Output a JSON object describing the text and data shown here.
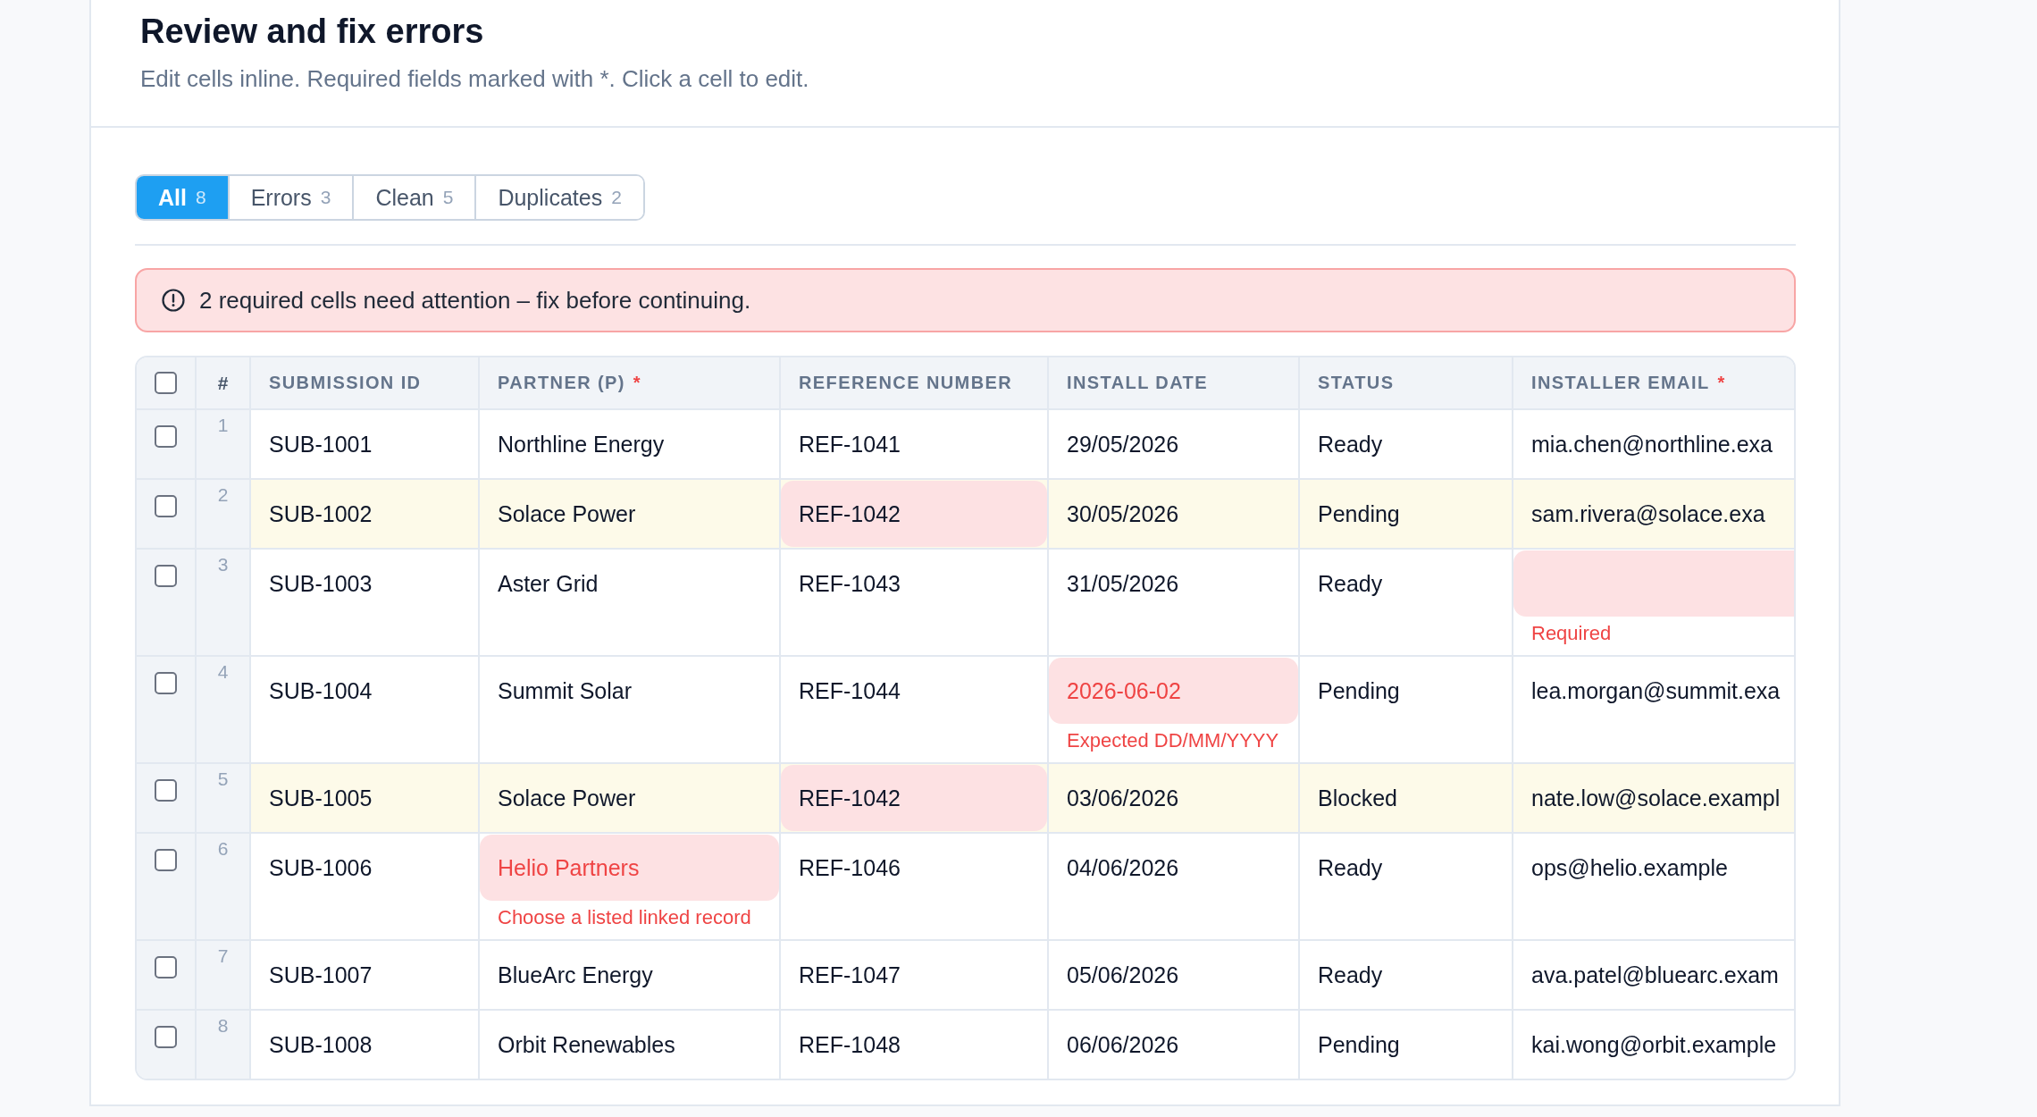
{
  "page": {
    "title": "Review and fix errors",
    "subtitle": "Edit cells inline. Required fields marked with *. Click a cell to edit."
  },
  "filter_tabs": [
    {
      "label": "All",
      "count": "8",
      "selected": true
    },
    {
      "label": "Errors",
      "count": "3",
      "selected": false
    },
    {
      "label": "Clean",
      "count": "5",
      "selected": false
    },
    {
      "label": "Duplicates",
      "count": "2",
      "selected": false
    }
  ],
  "alert": {
    "kind": "error",
    "message": "2 required cells need attention – fix before continuing."
  },
  "table": {
    "select_all_checked": false,
    "index_label": "#",
    "columns": [
      {
        "label": "SUBMISSION ID"
      },
      {
        "label": "PARTNER (P)",
        "marker": "*"
      },
      {
        "label": "REFERENCE NUMBER"
      },
      {
        "label": "INSTALL DATE"
      },
      {
        "label": "STATUS"
      },
      {
        "label": "INSTALLER EMAIL",
        "marker": "*"
      }
    ],
    "rows": [
      {
        "number": "1",
        "checked": false,
        "duplicate": false,
        "cells": [
          {
            "value": "SUB-1001",
            "kind": "plain"
          },
          {
            "value": "Northline Energy",
            "kind": "plain"
          },
          {
            "value": "REF-1041",
            "kind": "plain"
          },
          {
            "value": "29/05/2026",
            "kind": "plain"
          },
          {
            "value": "Ready",
            "kind": "plain"
          },
          {
            "value": "mia.chen@northline.exa",
            "kind": "plain"
          }
        ]
      },
      {
        "number": "2",
        "checked": false,
        "duplicate": true,
        "cells": [
          {
            "value": "SUB-1002",
            "kind": "plain"
          },
          {
            "value": "Solace Power",
            "kind": "plain"
          },
          {
            "value": "REF-1042",
            "kind": "duplicate"
          },
          {
            "value": "30/05/2026",
            "kind": "plain"
          },
          {
            "value": "Pending",
            "kind": "plain"
          },
          {
            "value": "sam.rivera@solace.exa",
            "kind": "plain"
          }
        ]
      },
      {
        "number": "3",
        "checked": false,
        "duplicate": false,
        "cells": [
          {
            "value": "SUB-1003",
            "kind": "plain"
          },
          {
            "value": "Aster Grid",
            "kind": "plain"
          },
          {
            "value": "REF-1043",
            "kind": "plain"
          },
          {
            "value": "31/05/2026",
            "kind": "plain"
          },
          {
            "value": "Ready",
            "kind": "plain"
          },
          {
            "kind": "invalid",
            "message": "Required"
          }
        ]
      },
      {
        "number": "4",
        "checked": false,
        "duplicate": false,
        "cells": [
          {
            "value": "SUB-1004",
            "kind": "plain"
          },
          {
            "value": "Summit Solar",
            "kind": "plain"
          },
          {
            "value": "REF-1044",
            "kind": "plain"
          },
          {
            "value": "2026-06-02",
            "kind": "invalid",
            "message": "Expected DD/MM/YYYY"
          },
          {
            "value": "Pending",
            "kind": "plain"
          },
          {
            "value": "lea.morgan@summit.exa",
            "kind": "plain"
          }
        ]
      },
      {
        "number": "5",
        "checked": false,
        "duplicate": true,
        "cells": [
          {
            "value": "SUB-1005",
            "kind": "plain"
          },
          {
            "value": "Solace Power",
            "kind": "plain"
          },
          {
            "value": "REF-1042",
            "kind": "duplicate"
          },
          {
            "value": "03/06/2026",
            "kind": "plain"
          },
          {
            "value": "Blocked",
            "kind": "plain"
          },
          {
            "value": "nate.low@solace.exampl",
            "kind": "plain"
          }
        ]
      },
      {
        "number": "6",
        "checked": false,
        "duplicate": false,
        "cells": [
          {
            "value": "SUB-1006",
            "kind": "plain"
          },
          {
            "value": "Helio Partners",
            "kind": "invalid",
            "message": "Choose a listed linked record"
          },
          {
            "value": "REF-1046",
            "kind": "plain"
          },
          {
            "value": "04/06/2026",
            "kind": "plain"
          },
          {
            "value": "Ready",
            "kind": "plain"
          },
          {
            "value": "ops@helio.example",
            "kind": "plain"
          }
        ]
      },
      {
        "number": "7",
        "checked": false,
        "duplicate": false,
        "cells": [
          {
            "value": "SUB-1007",
            "kind": "plain"
          },
          {
            "value": "BlueArc Energy",
            "kind": "plain"
          },
          {
            "value": "REF-1047",
            "kind": "plain"
          },
          {
            "value": "05/06/2026",
            "kind": "plain"
          },
          {
            "value": "Ready",
            "kind": "plain"
          },
          {
            "value": "ava.patel@bluearc.exam",
            "kind": "plain"
          }
        ]
      },
      {
        "number": "8",
        "checked": false,
        "duplicate": false,
        "cells": [
          {
            "value": "SUB-1008",
            "kind": "plain"
          },
          {
            "value": "Orbit Renewables",
            "kind": "plain"
          },
          {
            "value": "REF-1048",
            "kind": "plain"
          },
          {
            "value": "06/06/2026",
            "kind": "plain"
          },
          {
            "value": "Pending",
            "kind": "plain"
          },
          {
            "value": "kai.wong@orbit.example",
            "kind": "plain"
          }
        ]
      }
    ]
  }
}
